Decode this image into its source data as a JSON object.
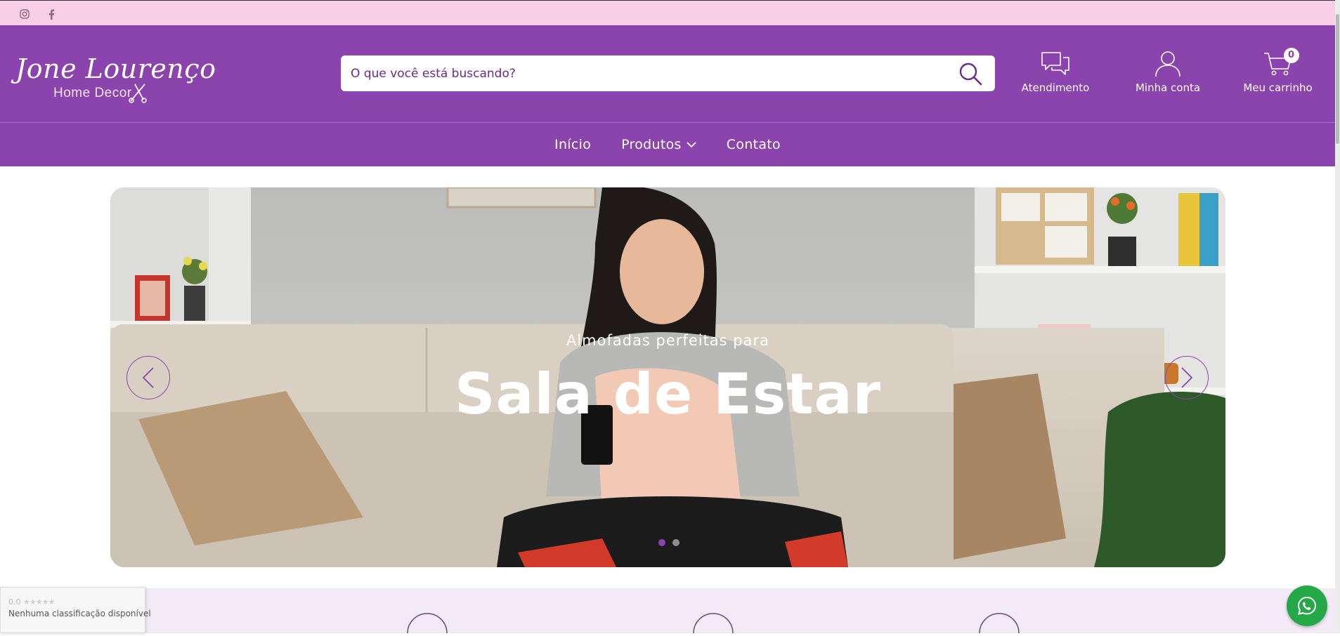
{
  "topbar": {
    "social": [
      {
        "icon": "instagram-icon"
      },
      {
        "icon": "facebook-icon"
      }
    ]
  },
  "header": {
    "logo": {
      "title": "Jone Lourenço",
      "subtitle": "Home Decor"
    },
    "search": {
      "placeholder": "O que você está buscando?"
    },
    "actions": {
      "support_label": "Atendimento",
      "account_label": "Minha conta",
      "cart_label": "Meu carrinho",
      "cart_count": "0"
    }
  },
  "nav": {
    "items": [
      "Início",
      "Produtos",
      "Contato"
    ]
  },
  "hero": {
    "pre_title": "Almofadas perfeitas para",
    "title": "Sala de Estar",
    "slides_total": 2,
    "active_slide": 1
  },
  "rating_widget": {
    "score": "0.0",
    "message": "Nenhuma classificação disponível"
  },
  "colors": {
    "primary": "#8b44ad",
    "topbar": "#f7d0e8",
    "whatsapp": "#25a848"
  }
}
